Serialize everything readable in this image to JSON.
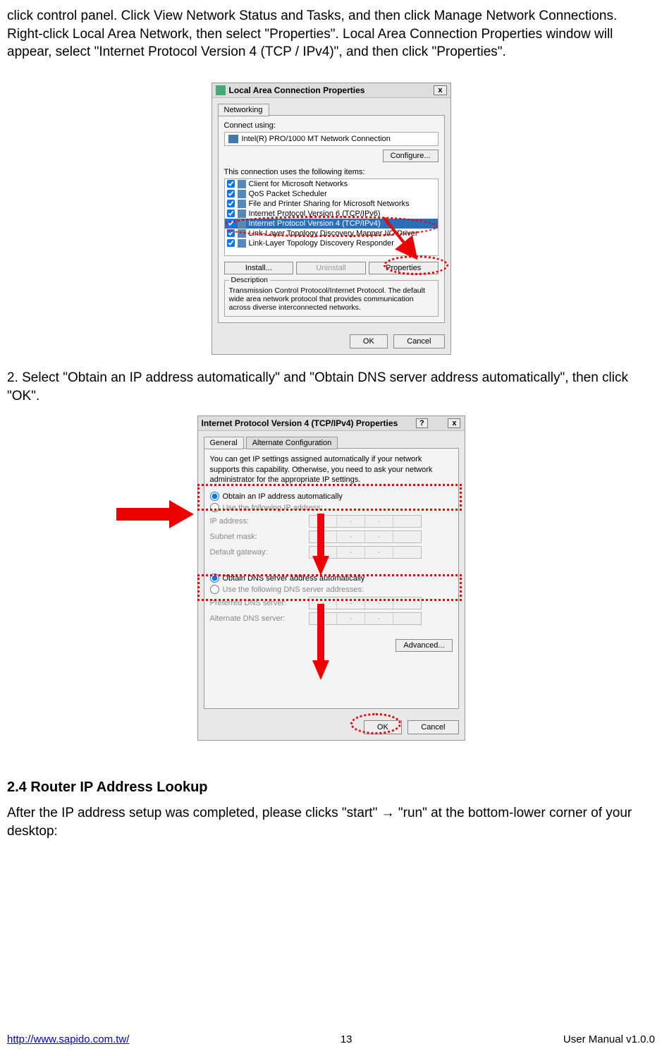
{
  "intro": "click control panel. Click View Network Status and Tasks, and then click Manage Network Connections. Right-click Local Area Network, then select \"Properties\". Local Area Connection Properties window will appear, select \"Internet Protocol Version 4 (TCP / IPv4)\", and then click \"Properties\".",
  "dialog1": {
    "title": "Local Area Connection Properties",
    "close": "x",
    "tab": "Networking",
    "connect_using_label": "Connect using:",
    "adapter": "Intel(R) PRO/1000 MT Network Connection",
    "configure_btn": "Configure...",
    "items_label": "This connection uses the following items:",
    "items": [
      "Client for Microsoft Networks",
      "QoS Packet Scheduler",
      "File and Printer Sharing for Microsoft Networks",
      "Internet Protocol Version 6 (TCP/IPv6)",
      "Internet Protocol Version 4 (TCP/IPv4)",
      "Link-Layer Topology Discovery Mapper I/O Driver",
      "Link-Layer Topology Discovery Responder"
    ],
    "install_btn": "Install...",
    "uninstall_btn": "Uninstall",
    "properties_btn": "Properties",
    "desc_legend": "Description",
    "desc_text": "Transmission Control Protocol/Internet Protocol. The default wide area network protocol that provides communication across diverse interconnected networks.",
    "ok_btn": "OK",
    "cancel_btn": "Cancel"
  },
  "step2": "2.    Select \"Obtain an IP address automatically\" and \"Obtain DNS server address automatically\", then click \"OK\".",
  "dialog2": {
    "title": "Internet Protocol Version 4 (TCP/IPv4) Properties",
    "help": "?",
    "close": "x",
    "tab_general": "General",
    "tab_alt": "Alternate Configuration",
    "info": "You can get IP settings assigned automatically if your network supports this capability. Otherwise, you need to ask your network administrator for the appropriate IP settings.",
    "radio_ip_auto": "Obtain an IP address automatically",
    "radio_ip_manual": "Use the following IP address:",
    "ip_label": "IP address:",
    "subnet_label": "Subnet mask:",
    "gateway_label": "Default gateway:",
    "radio_dns_auto": "Obtain DNS server address automatically",
    "radio_dns_manual": "Use the following DNS server addresses:",
    "pref_dns_label": "Preferred DNS server:",
    "alt_dns_label": "Alternate DNS server:",
    "advanced_btn": "Advanced...",
    "ok_btn": "OK",
    "cancel_btn": "Cancel"
  },
  "section": {
    "heading": "2.4    Router IP Address Lookup",
    "body": "After the IP address setup was completed, please clicks \"start\" → \"run\" at the bottom-lower corner of your desktop:"
  },
  "footer": {
    "url": "http://www.sapido.com.tw/",
    "page": "13",
    "version": "User  Manual  v1.0.0"
  }
}
